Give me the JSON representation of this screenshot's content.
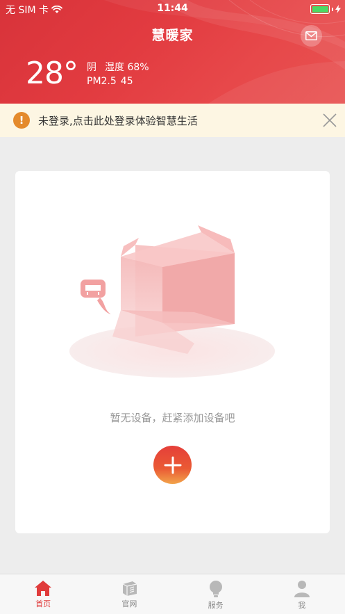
{
  "status_bar": {
    "carrier": "无 SIM 卡",
    "time": "11:44",
    "battery_level": 1.0
  },
  "header": {
    "title": "慧暖家",
    "mail_icon": "mail-icon"
  },
  "weather": {
    "temperature": "28°",
    "condition": "阴",
    "humidity": "湿度 68%",
    "pm_label": "PM2.5",
    "pm_value": "45"
  },
  "notice": {
    "text": "未登录,点击此处登录体验智慧生活",
    "icon": "!",
    "color": "#e48a2c"
  },
  "empty_state": {
    "message": "暂无设备，赶紧添加设备吧",
    "add_icon": "plus-icon"
  },
  "tabs": [
    {
      "label": "首页",
      "icon": "home-icon",
      "active": true
    },
    {
      "label": "官网",
      "icon": "website-icon",
      "active": false
    },
    {
      "label": "服务",
      "icon": "bulb-icon",
      "active": false
    },
    {
      "label": "我",
      "icon": "user-icon",
      "active": false
    }
  ],
  "colors": {
    "brand_red": "#e03b3b",
    "header_red": "#d8333a",
    "notice_bg": "#fdf6e3"
  }
}
